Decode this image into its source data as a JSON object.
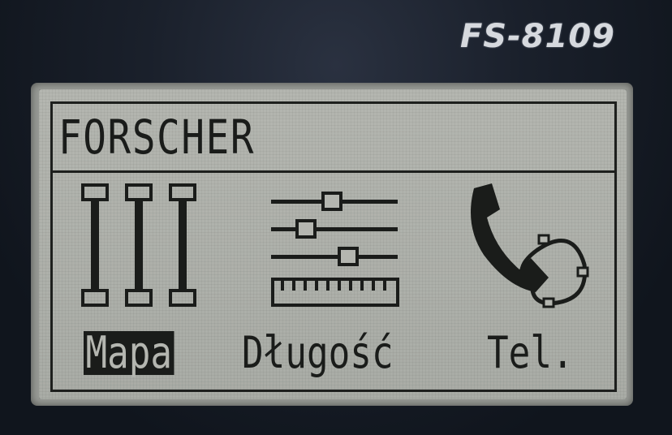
{
  "device": {
    "model": "FS-8109"
  },
  "screen": {
    "title": "FORSCHER",
    "menu": [
      {
        "label": "Mapa",
        "icon": "bars-icon",
        "selected": true
      },
      {
        "label": "Długość",
        "icon": "sliders-ruler-icon",
        "selected": false
      },
      {
        "label": "Tel.",
        "icon": "phone-icon",
        "selected": false
      }
    ]
  },
  "colors": {
    "lcd_background": "#b4b6b0",
    "lcd_ink": "#1a1c1a",
    "case": "#1a202b"
  }
}
